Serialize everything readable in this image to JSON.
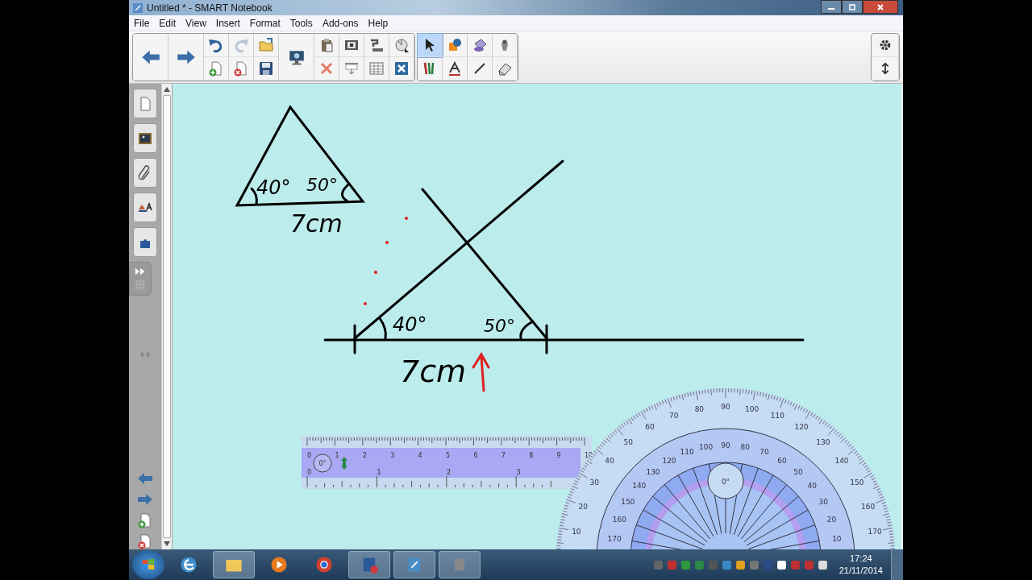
{
  "window": {
    "title": "Untitled * - SMART Notebook"
  },
  "menu": [
    "File",
    "Edit",
    "View",
    "Insert",
    "Format",
    "Tools",
    "Add-ons",
    "Help"
  ],
  "tools": [
    {
      "kind": "select",
      "selected": true
    },
    {
      "kind": "shapes",
      "selected": false
    },
    {
      "kind": "fill",
      "selected": false
    },
    {
      "kind": "magic",
      "selected": false
    },
    {
      "kind": "pens",
      "selected": false
    },
    {
      "kind": "text",
      "selected": false
    },
    {
      "kind": "line",
      "selected": false
    },
    {
      "kind": "eraser",
      "selected": false
    }
  ],
  "canvas": {
    "labels": [
      "40°",
      "50°",
      "7cm",
      "40°",
      "50°",
      "7cm"
    ]
  },
  "ruler": {
    "top_numbers": [
      "0",
      "1",
      "2",
      "3",
      "4",
      "5",
      "6",
      "7",
      "8",
      "9",
      "10"
    ],
    "bottom_numbers": [
      "0",
      "1",
      "2",
      "3"
    ],
    "angle": "0°"
  },
  "protractor": {
    "outer_numbers": [
      "10",
      "20",
      "30",
      "40",
      "50",
      "60",
      "70",
      "80",
      "90",
      "100",
      "110",
      "120",
      "130",
      "140",
      "150",
      "160",
      "170"
    ],
    "inner_numbers": [
      "170",
      "160",
      "150",
      "140",
      "130",
      "120",
      "110",
      "100",
      "90",
      "80",
      "70",
      "60",
      "50",
      "40",
      "30",
      "20",
      "10"
    ],
    "angle": "0°"
  },
  "taskbar": {
    "time": "17:24",
    "date": "21/11/2014"
  }
}
